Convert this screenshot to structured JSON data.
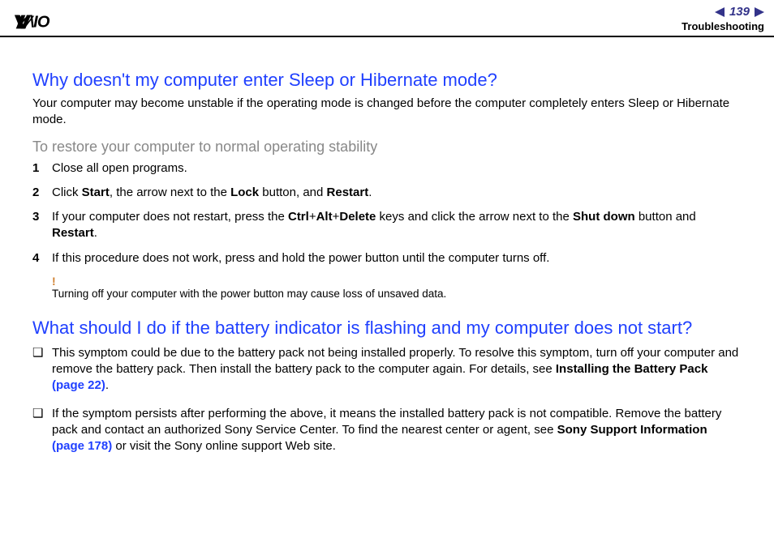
{
  "header": {
    "page_number": "139",
    "breadcrumb": "Troubleshooting"
  },
  "section1": {
    "heading": "Why doesn't my computer enter Sleep or Hibernate mode?",
    "intro": "Your computer may become unstable if the operating mode is changed before the computer completely enters Sleep or Hibernate mode.",
    "subhead": "To restore your computer to normal operating stability",
    "steps": [
      {
        "n": "1",
        "html": "Close all open programs."
      },
      {
        "n": "2",
        "html": "Click <b>Start</b>, the arrow next to the <b>Lock</b> button, and <b>Restart</b>."
      },
      {
        "n": "3",
        "html": "If your computer does not restart, press the <b>Ctrl</b>+<b>Alt</b>+<b>Delete</b> keys and click the arrow next to the <b>Shut down</b> button and <b>Restart</b>."
      },
      {
        "n": "4",
        "html": "If this procedure does not work, press and hold the power button until the computer turns off."
      }
    ],
    "note_mark": "!",
    "note": "Turning off your computer with the power button may cause loss of unsaved data."
  },
  "section2": {
    "heading": "What should I do if the battery indicator is flashing and my computer does not start?",
    "bullets": [
      {
        "html": "This symptom could be due to the battery pack not being installed properly. To resolve this symptom, turn off your computer and remove the battery pack. Then install the battery pack to the computer again. For details, see <b>Installing the Battery Pack </b><span class='link'>(page 22)</span>."
      },
      {
        "html": "If the symptom persists after performing the above, it means the installed battery pack is not compatible. Remove the battery pack and contact an authorized Sony Service Center. To find the nearest center or agent, see <b>Sony Support Information </b><span class='link'>(page 178)</span> or visit the Sony online support Web site."
      }
    ]
  }
}
